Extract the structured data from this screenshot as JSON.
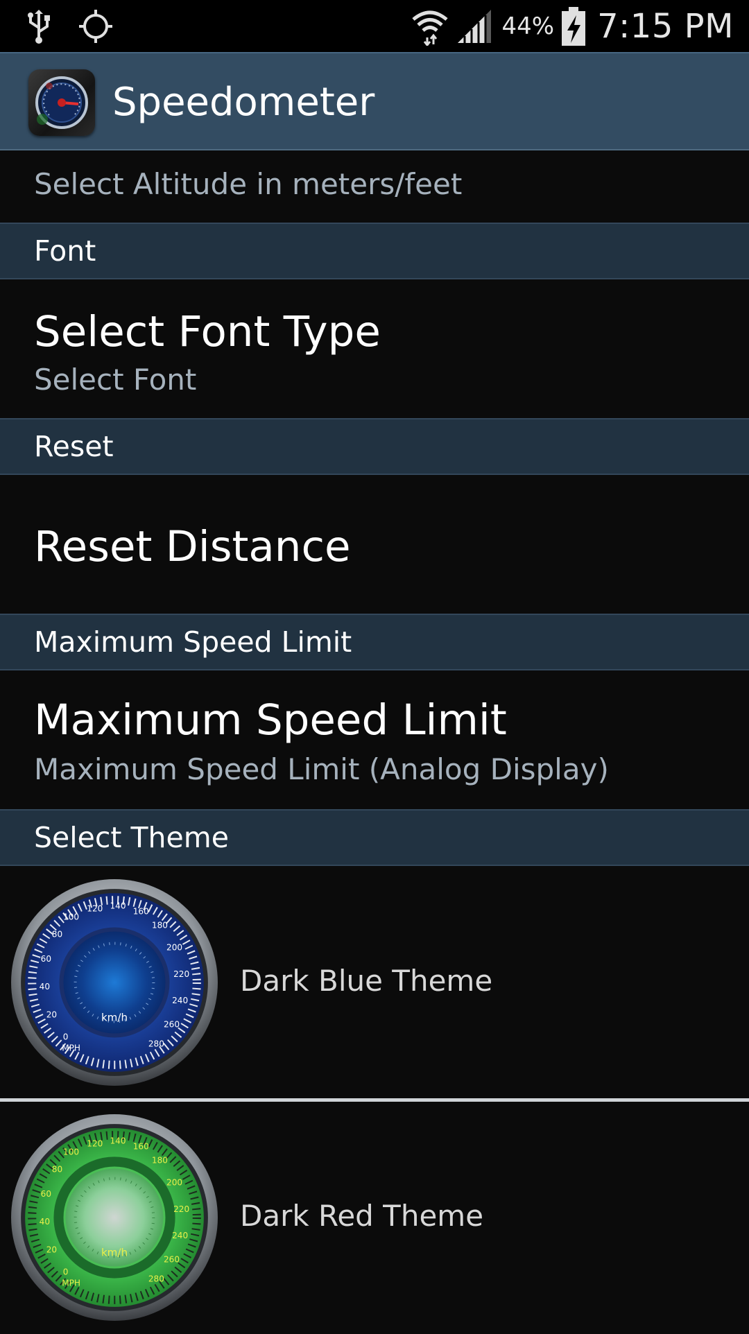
{
  "status_bar": {
    "left_icons": [
      "usb-icon",
      "gps-icon"
    ],
    "right_icons": [
      "wifi-icon",
      "signal-icon",
      "battery-charging-icon"
    ],
    "battery_percent": "44%",
    "time": "7:15 PM"
  },
  "action_bar": {
    "title": "Speedometer",
    "icon": "speedometer-app-icon"
  },
  "preferences": {
    "altitude_summary": "Select Altitude in meters/feet",
    "font_header": "Font",
    "font_title": "Select Font Type",
    "font_summary": "Select Font",
    "reset_header": "Reset",
    "reset_title": "Reset Distance",
    "speed_header": "Maximum Speed Limit",
    "speed_title": "Maximum Speed Limit",
    "speed_summary": "Maximum Speed Limit (Analog Display)",
    "theme_header": "Select Theme"
  },
  "themes": [
    {
      "label": "Dark Blue Theme",
      "accent": "#1b3fa0"
    },
    {
      "label": "Dark Red Theme",
      "accent": "#39b64a"
    }
  ],
  "gauge_labels": {
    "outer_ticks": [
      "0",
      "20",
      "40",
      "60",
      "80",
      "100",
      "120",
      "140",
      "160",
      "180",
      "200",
      "220",
      "240",
      "260",
      "280"
    ],
    "unit": "km/h",
    "sub_unit": "MPH"
  },
  "colors": {
    "action_bar": "#334c62",
    "section_header": "#213241",
    "background": "#0b0b0b",
    "summary_text": "#a6b2bd"
  }
}
